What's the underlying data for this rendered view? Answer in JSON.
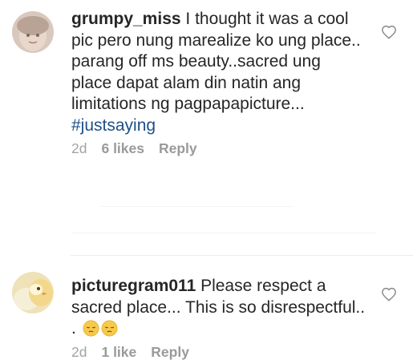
{
  "comments": [
    {
      "username": "grumpy_miss",
      "lines": [
        " I thought it was a cool",
        "pic pero nung marealize ko ung place..",
        "parang off ms beauty..sacred ung",
        "place dapat alam din natin ang",
        "limitations ng pagpapapicture..."
      ],
      "hashtag": "#justsaying",
      "time": "2d",
      "likes": "6 likes",
      "reply_label": "Reply",
      "like_icon": "heart-outline-icon"
    },
    {
      "username": "picturegram011",
      "lines": [
        " Please respect a",
        "sacred place... This is so disrespectful..",
        "."
      ],
      "emojis": [
        "pensive-face-icon",
        "pensive-face-icon"
      ],
      "time": "2d",
      "likes": "1 like",
      "reply_label": "Reply",
      "like_icon": "heart-outline-icon"
    }
  ],
  "colors": {
    "text": "#262626",
    "meta": "#9a9a9a",
    "hashtag": "#1f4f86",
    "divider": "#ececec"
  }
}
